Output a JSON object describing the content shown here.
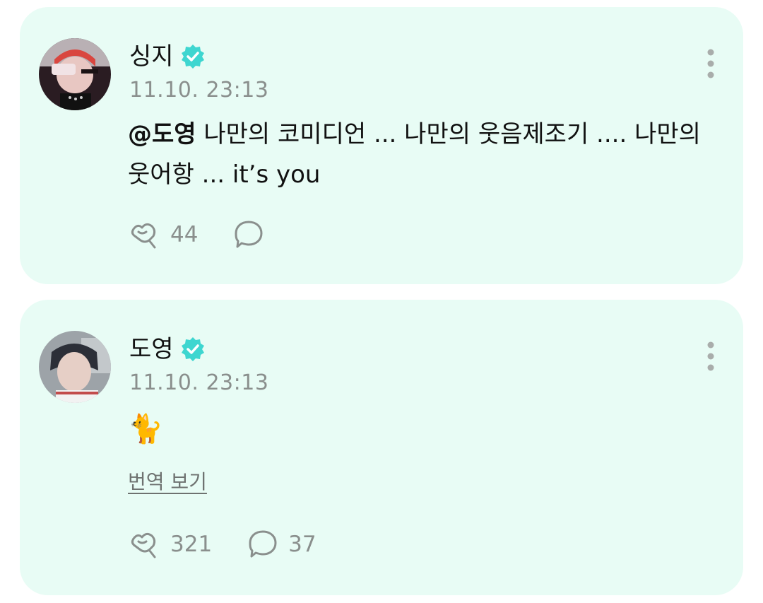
{
  "posts": [
    {
      "author": "싱지",
      "verified": true,
      "timestamp": "11.10. 23:13",
      "mention": "@도영",
      "text": " 나만의 코미디언 ... 나만의 웃음제조기 .... 나만의 웃어항 ... it’s you",
      "likes": "44",
      "comments": "",
      "avatar_icon": "avatar-photo"
    },
    {
      "author": "도영",
      "verified": true,
      "timestamp": "11.10. 23:13",
      "emoji": "🐈",
      "translate_label": "번역 보기",
      "likes": "321",
      "comments": "37",
      "avatar_icon": "avatar-photo"
    }
  ],
  "colors": {
    "card_bg": "#e8fcf5",
    "verified": "#3ed6d0",
    "muted": "#8a8f8d"
  },
  "icons": [
    "verified-badge-icon",
    "more-vertical-icon",
    "like-icon",
    "comment-icon"
  ]
}
